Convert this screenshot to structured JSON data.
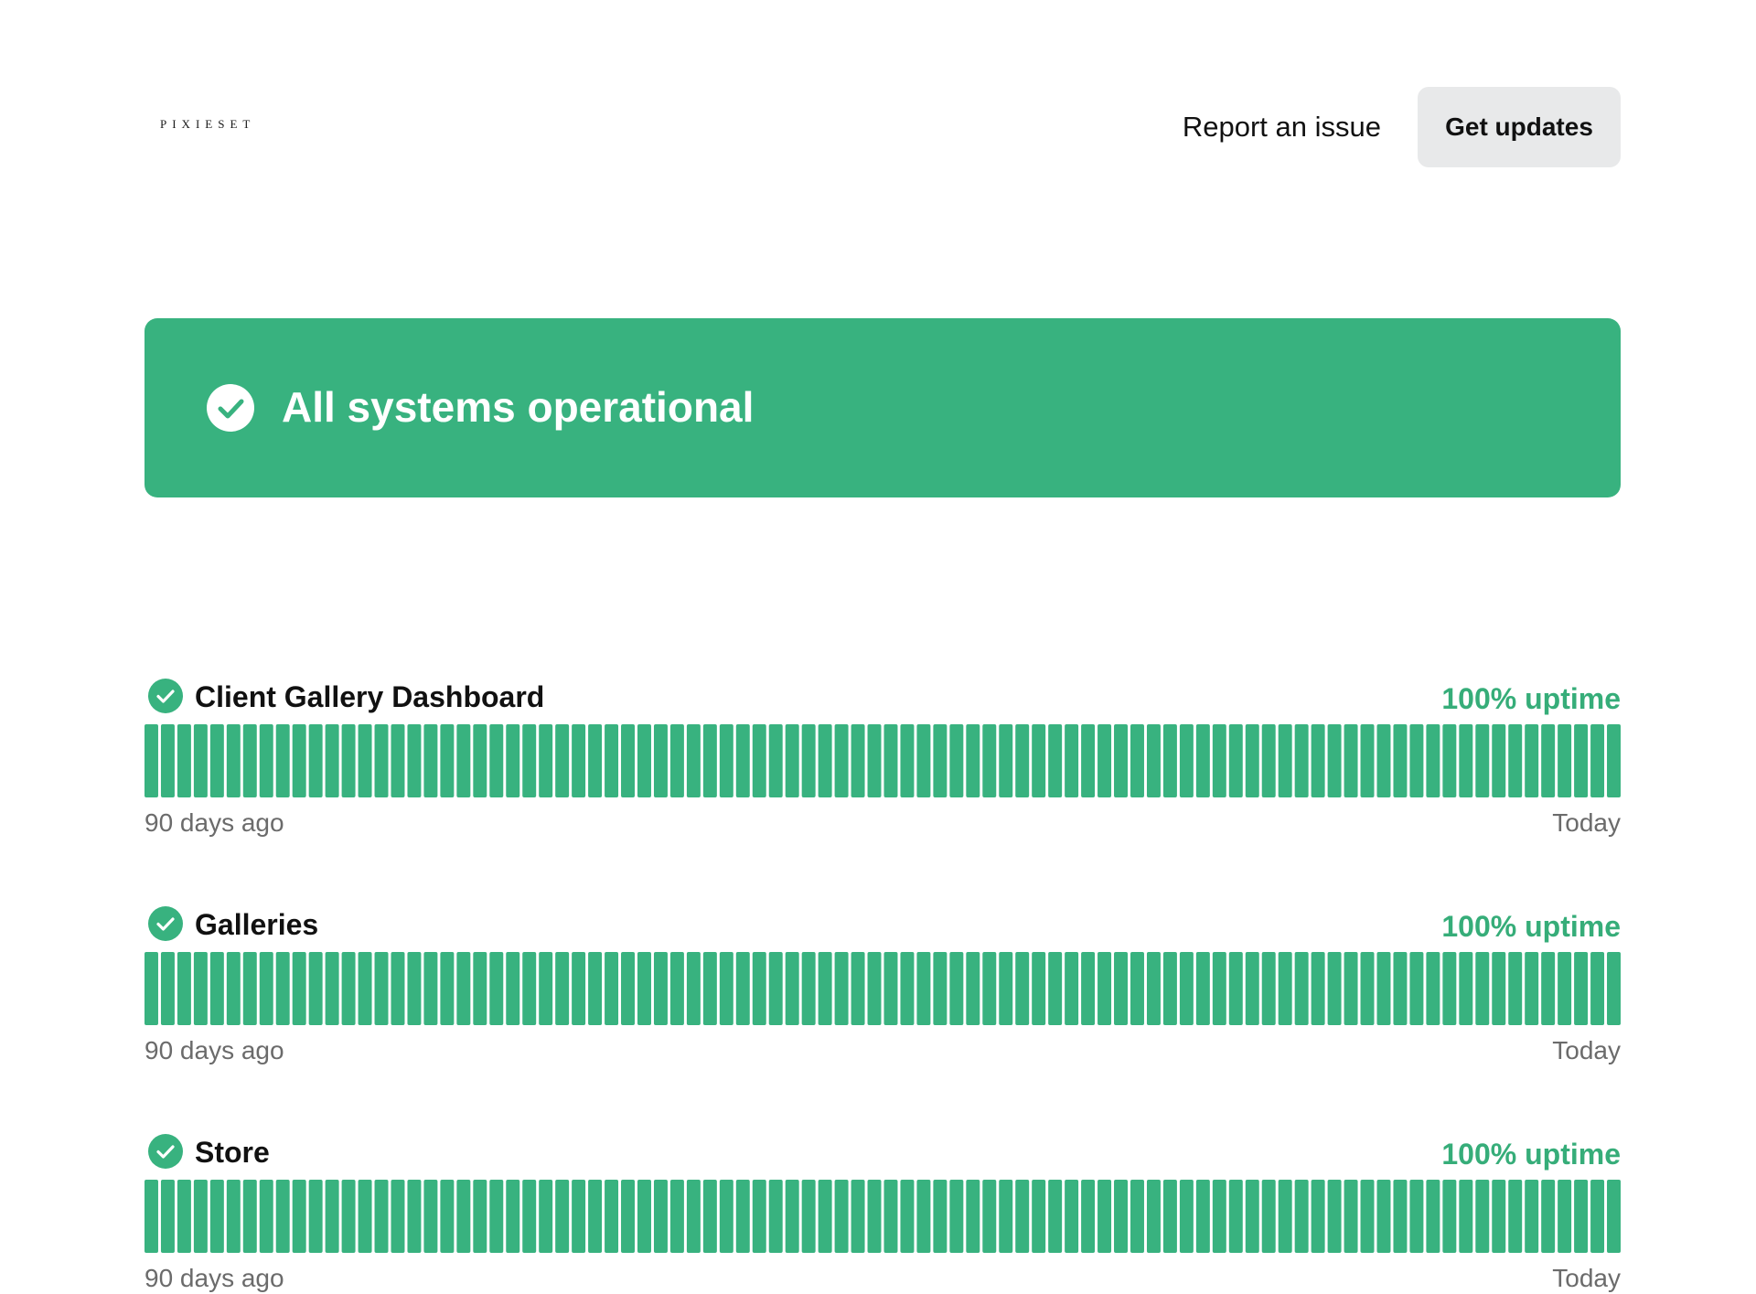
{
  "header": {
    "logo": "PIXIESET",
    "report_label": "Report an issue",
    "updates_label": "Get updates"
  },
  "banner": {
    "text": "All systems operational",
    "icon": "check-circle-icon"
  },
  "colors": {
    "operational": "#38b27f",
    "uptime_text": "#36ad79",
    "button_bg": "#e8e9ea"
  },
  "components": [
    {
      "name": "Client Gallery Dashboard",
      "uptime": "100% uptime",
      "icon": "check-circle-icon",
      "start_label": "90 days ago",
      "end_label": "Today",
      "days": 90
    },
    {
      "name": "Galleries",
      "uptime": "100% uptime",
      "icon": "check-circle-icon",
      "start_label": "90 days ago",
      "end_label": "Today",
      "days": 90
    },
    {
      "name": "Store",
      "uptime": "100% uptime",
      "icon": "check-circle-icon",
      "start_label": "90 days ago",
      "end_label": "Today",
      "days": 90
    }
  ]
}
